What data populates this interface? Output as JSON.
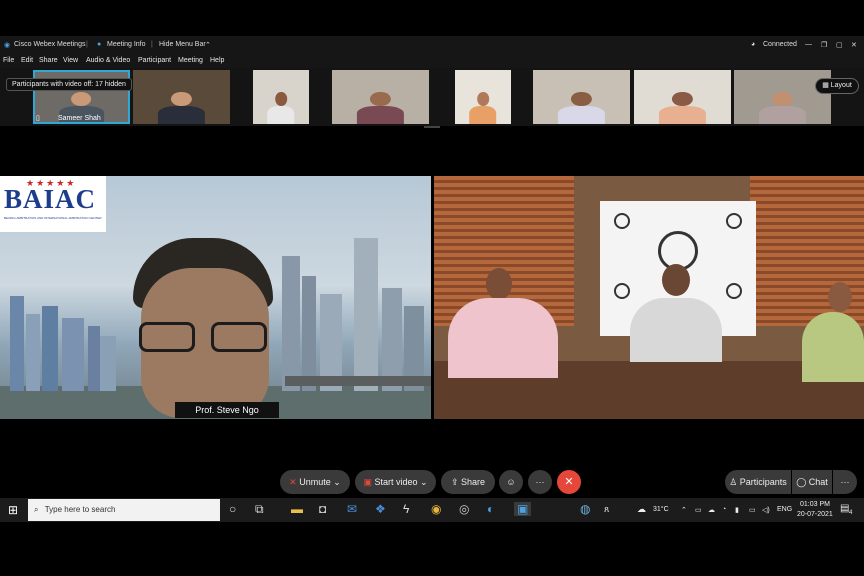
{
  "window": {
    "app_title": "Cisco Webex Meetings",
    "meeting_info": "Meeting Info",
    "hide_menu_bar": "Hide Menu Bar",
    "connection_status": "Connected"
  },
  "menu": [
    "File",
    "Edit",
    "Share",
    "View",
    "Audio & Video",
    "Participant",
    "Meeting",
    "Help"
  ],
  "filmstrip": {
    "tooltip": "Participants with video off: 17 hidden",
    "active_participant_name": "Sameer Shah",
    "layout_label": "Layout"
  },
  "main": {
    "left_pane_logo_text": "BAIAC",
    "left_pane_logo_subtitle": "BEIJING ARBITRATION AND INTERNATIONAL ARBITRATION CENTER",
    "speaker_name": "Prof. Steve Ngo"
  },
  "controls": {
    "unmute": "Unmute",
    "start_video": "Start video",
    "share": "Share",
    "more": "···",
    "participants": "Participants",
    "chat": "Chat"
  },
  "taskbar": {
    "search_placeholder": "Type here to search",
    "temperature": "31°C",
    "language": "ENG",
    "time": "01:03 PM",
    "date": "20-07-2021",
    "notification_count": "4"
  },
  "colors": {
    "end_call": "#e5473b",
    "active_border": "#2fa8d8",
    "logo_blue": "#1d3d8c"
  }
}
